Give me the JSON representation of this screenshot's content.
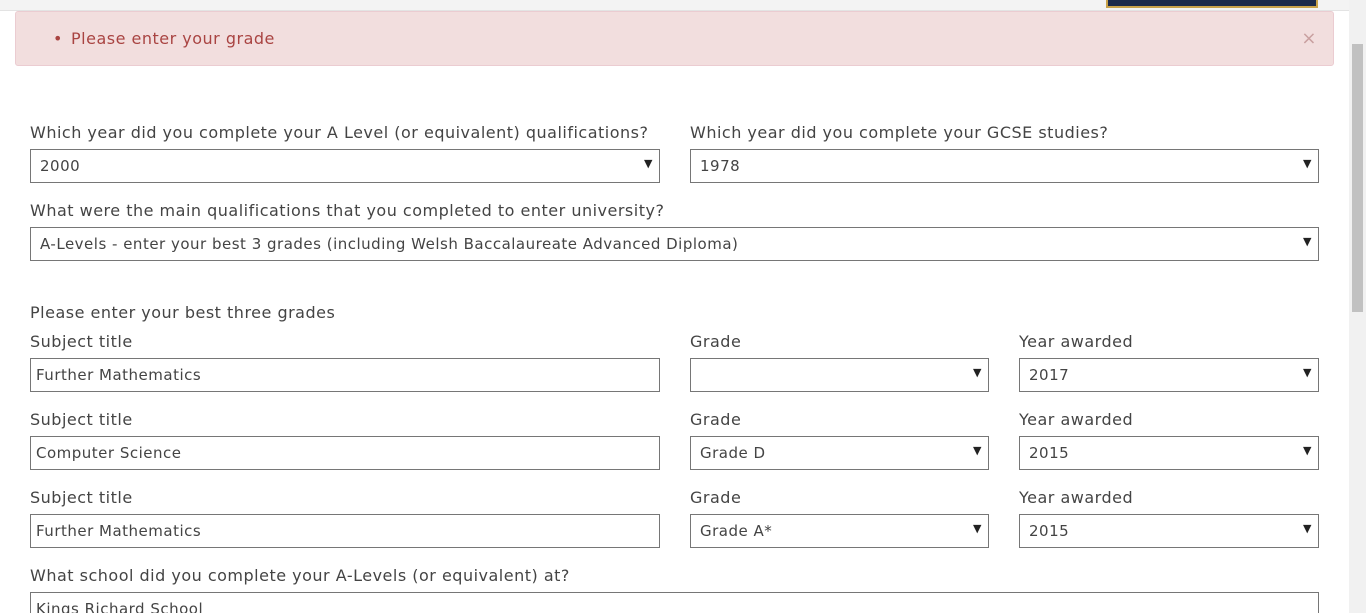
{
  "alert": {
    "bullet": "•",
    "message": "Please enter your grade",
    "close": "×"
  },
  "form": {
    "alevel_year": {
      "label": "Which year did you complete your A Level (or equivalent) qualifications?",
      "value": "2000"
    },
    "gcse_year": {
      "label": "Which year did you complete your GCSE studies?",
      "value": "1978"
    },
    "main_qualifications": {
      "label": "What were the main qualifications that you completed to enter university?",
      "value": "A-Levels - enter your best 3 grades (including Welsh Baccalaureate Advanced Diploma)"
    },
    "best_three_heading": "Please enter your best three grades",
    "grades": [
      {
        "subject_label": "Subject title",
        "subject_value": "Further Mathematics",
        "grade_label": "Grade",
        "grade_value": "",
        "year_label": "Year awarded",
        "year_value": "2017"
      },
      {
        "subject_label": "Subject title",
        "subject_value": "Computer Science",
        "grade_label": "Grade",
        "grade_value": "Grade D",
        "year_label": "Year awarded",
        "year_value": "2015"
      },
      {
        "subject_label": "Subject title",
        "subject_value": "Further Mathematics",
        "grade_label": "Grade",
        "grade_value": "Grade A*",
        "year_label": "Year awarded",
        "year_value": "2015"
      }
    ],
    "school": {
      "label": "What school did you complete your A-Levels (or equivalent) at?",
      "value": "Kings Richard School"
    }
  },
  "icons": {
    "dropdown_arrow": "▼"
  },
  "colors": {
    "alert_bg": "#f2dede",
    "alert_text": "#a94442",
    "header_navy": "#1c2a4a",
    "header_gold": "#c9a24a"
  }
}
